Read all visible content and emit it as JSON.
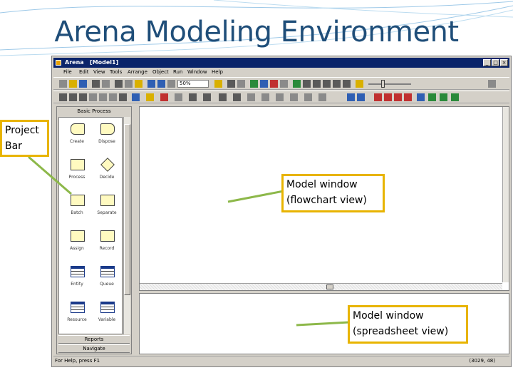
{
  "slide": {
    "title": "Arena Modeling Environment"
  },
  "window": {
    "app_name": "Arena",
    "doc_name": "[Model1]",
    "controls": [
      "_",
      "□",
      "×"
    ]
  },
  "menu": [
    "File",
    "Edit",
    "View",
    "Tools",
    "Arrange",
    "Object",
    "Run",
    "Window",
    "Help"
  ],
  "toolbar": {
    "zoom_value": "50%"
  },
  "project_bar": {
    "panel_title": "Basic Process",
    "modules": [
      {
        "label": "Create",
        "icon": "create-module-icon"
      },
      {
        "label": "Dispose",
        "icon": "dispose-module-icon"
      },
      {
        "label": "Process",
        "icon": "process-module-icon"
      },
      {
        "label": "Decide",
        "icon": "decide-module-icon"
      },
      {
        "label": "Batch",
        "icon": "batch-module-icon"
      },
      {
        "label": "Separate",
        "icon": "separate-module-icon"
      },
      {
        "label": "Assign",
        "icon": "assign-module-icon"
      },
      {
        "label": "Record",
        "icon": "record-module-icon"
      },
      {
        "label": "Entity",
        "icon": "entity-table-icon"
      },
      {
        "label": "Queue",
        "icon": "queue-table-icon"
      },
      {
        "label": "Resource",
        "icon": "resource-table-icon"
      },
      {
        "label": "Variable",
        "icon": "variable-table-icon"
      }
    ],
    "footer_panels": [
      "Reports",
      "Navigate"
    ]
  },
  "status": {
    "left": "For Help, press F1",
    "coords": "(3029, 48)"
  },
  "callouts": {
    "project_bar": "Project\nBar",
    "flowchart": "Model window\n(flowchart view)",
    "spreadsheet": "Model window\n(spreadsheet view)"
  },
  "colors": {
    "title": "#1f4e79",
    "callout_border": "#e8b400",
    "connector": "#8db84a",
    "titlebar": "#0a246a"
  }
}
